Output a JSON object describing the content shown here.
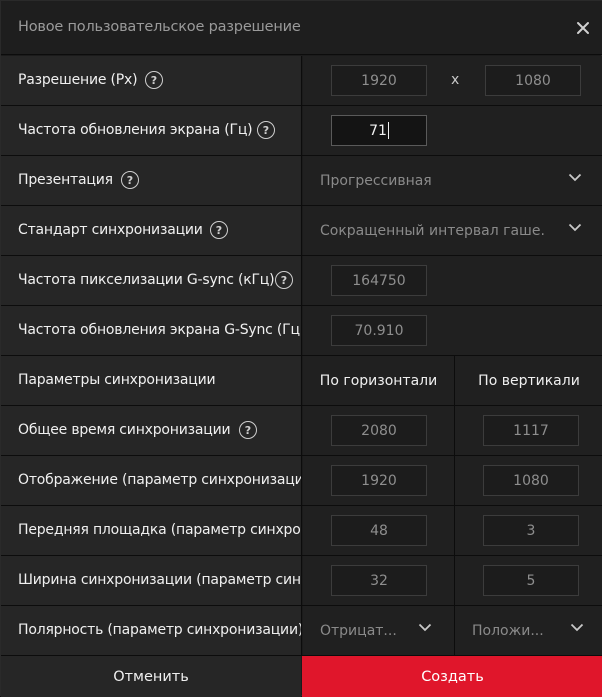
{
  "dialog": {
    "title": "Новое пользовательское разрешение",
    "close_icon": "close-icon"
  },
  "rows": {
    "resolution": {
      "label": "Разрешение (Px)",
      "width": "1920",
      "x": "x",
      "height": "1080"
    },
    "refresh": {
      "label": "Частота обновления экрана (Гц)",
      "value": "71"
    },
    "presentation": {
      "label": "Презентация",
      "value": "Прогрессивная"
    },
    "timing_standard": {
      "label": "Стандарт синхронизации",
      "value": "Сокращенный интервал гаше..."
    },
    "pixel_clock": {
      "label": "Частота пикселизации G-sync (кГц)",
      "value": "164750"
    },
    "gsync_refresh": {
      "label": "Частота обновления экрана G-Sync (Гц)",
      "value": "70.910"
    },
    "timing_params": {
      "label": "Параметры синхронизации",
      "horizontal": "По горизонтали",
      "vertical": "По вертикали"
    },
    "total": {
      "label": "Общее время синхронизации",
      "h": "2080",
      "v": "1117"
    },
    "display": {
      "label": "Отображение (параметр синхронизации)",
      "h": "1920",
      "v": "1080"
    },
    "front_porch": {
      "label": "Передняя площадка (параметр синхронизации)",
      "h": "48",
      "v": "3"
    },
    "sync_width": {
      "label": "Ширина синхронизации (параметр синхронизации)",
      "h": "32",
      "v": "5"
    },
    "polarity": {
      "label": "Полярность (параметр синхронизации)",
      "h": "Отрицат...",
      "v": "Положи..."
    }
  },
  "buttons": {
    "cancel": "Отменить",
    "create": "Создать"
  },
  "colors": {
    "accent": "#e0162b",
    "background": "#1b1b1b"
  }
}
